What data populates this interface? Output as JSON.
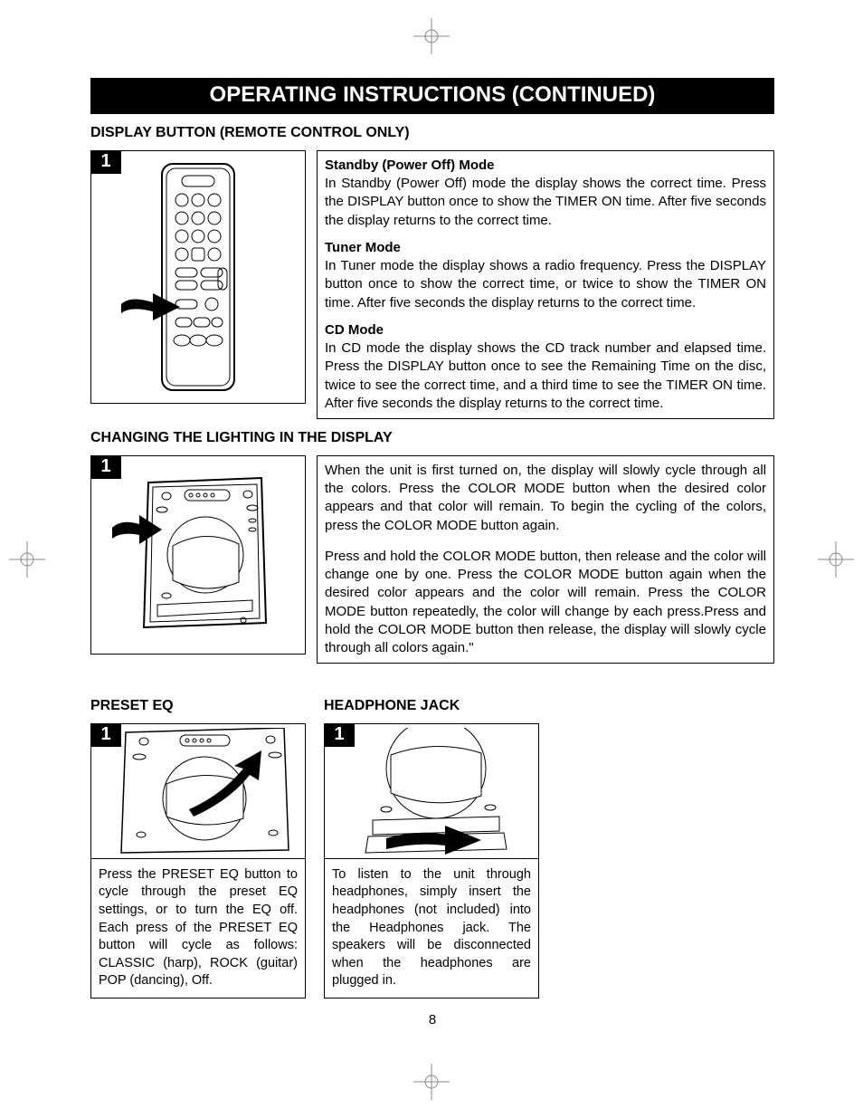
{
  "banner_title": "OPERATING INSTRUCTIONS (CONTINUED)",
  "page_number": "8",
  "section1": {
    "heading": "DISPLAY BUTTON (REMOTE CONTROL ONLY)",
    "step": "1",
    "standby_h": "Standby (Power Off) Mode",
    "standby_p": "In Standby (Power Off) mode the display shows the correct time. Press the DISPLAY button once to show the TIMER ON time. After five seconds the display returns to the correct time.",
    "tuner_h": "Tuner Mode",
    "tuner_p": "In Tuner mode the display shows a radio frequency. Press the DISPLAY button once to show the correct time, or twice to show the TIMER ON time. After five seconds the display returns to the correct time.",
    "cd_h": "CD Mode",
    "cd_p": "In CD mode the display shows the CD track number and elapsed time. Press the DISPLAY button once to see the Remaining Time on the disc, twice to see the correct time, and a third time to see the TIMER ON time. After five seconds the display returns to the correct time."
  },
  "section2": {
    "heading": "CHANGING THE LIGHTING IN THE DISPLAY",
    "step": "1",
    "p1": "When the unit is first turned on, the display will slowly cycle through all the colors. Press the COLOR MODE button when the desired color appears and that color will remain. To begin the cycling of the colors, press the COLOR MODE button again.",
    "p2": "Press and hold the COLOR MODE button, then release and the color will change one by one. Press the COLOR MODE button again when the desired color appears and the color will remain. Press the COLOR MODE button repeatedly, the color will change by each press.Press and hold the COLOR MODE button then release, the display will slowly cycle through all colors again.\""
  },
  "section3": {
    "heading": "PRESET EQ",
    "step": "1",
    "p": "Press the PRESET EQ button to cycle through the preset EQ settings, or to turn the EQ off. Each press of the PRESET EQ button will cycle as follows: CLASSIC (harp), ROCK (guitar) POP (dancing), Off."
  },
  "section4": {
    "heading": "HEADPHONE JACK",
    "step": "1",
    "p": "To listen to the unit through headphones, simply insert the headphones (not included) into the Headphones jack. The speakers will be disconnected when the headphones are plugged in."
  }
}
